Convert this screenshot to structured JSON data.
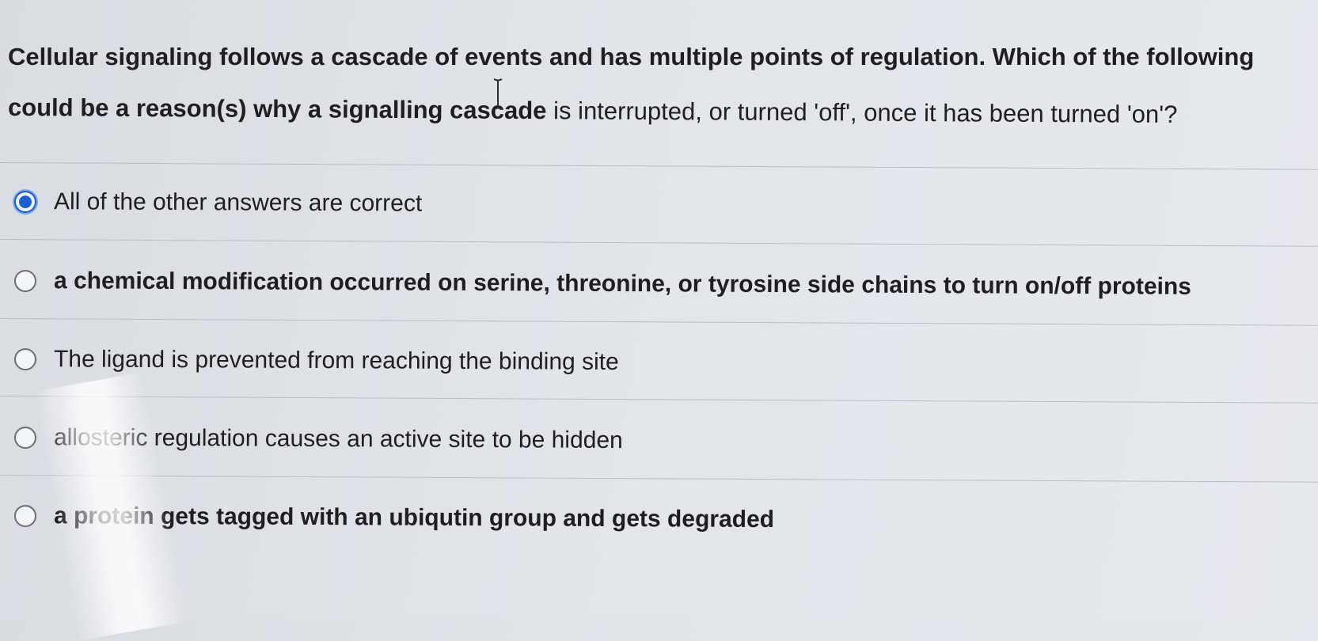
{
  "question": {
    "line1": "Cellular signaling follows a cascade of events and has multiple points of regulation. Which of the following",
    "line2_bold": "could be a reason(s) why a signalling cascade",
    "line2_normal": " is interrupted, or turned 'off', once it has been turned 'on'?"
  },
  "options": [
    {
      "label": "All of the other answers are correct",
      "selected": true
    },
    {
      "label": "a chemical modification occurred on serine, threonine, or tyrosine side chains to turn on/off proteins",
      "selected": false
    },
    {
      "label": "The ligand is prevented from reaching the binding site",
      "selected": false
    },
    {
      "label": "allosteric regulation causes an active site to be hidden",
      "selected": false
    },
    {
      "label": "a protein gets tagged with an ubiqutin group and gets degraded",
      "selected": false
    }
  ],
  "colors": {
    "accent": "#1a5fd6",
    "background": "#e1e5ea",
    "text": "#1d1f22"
  }
}
